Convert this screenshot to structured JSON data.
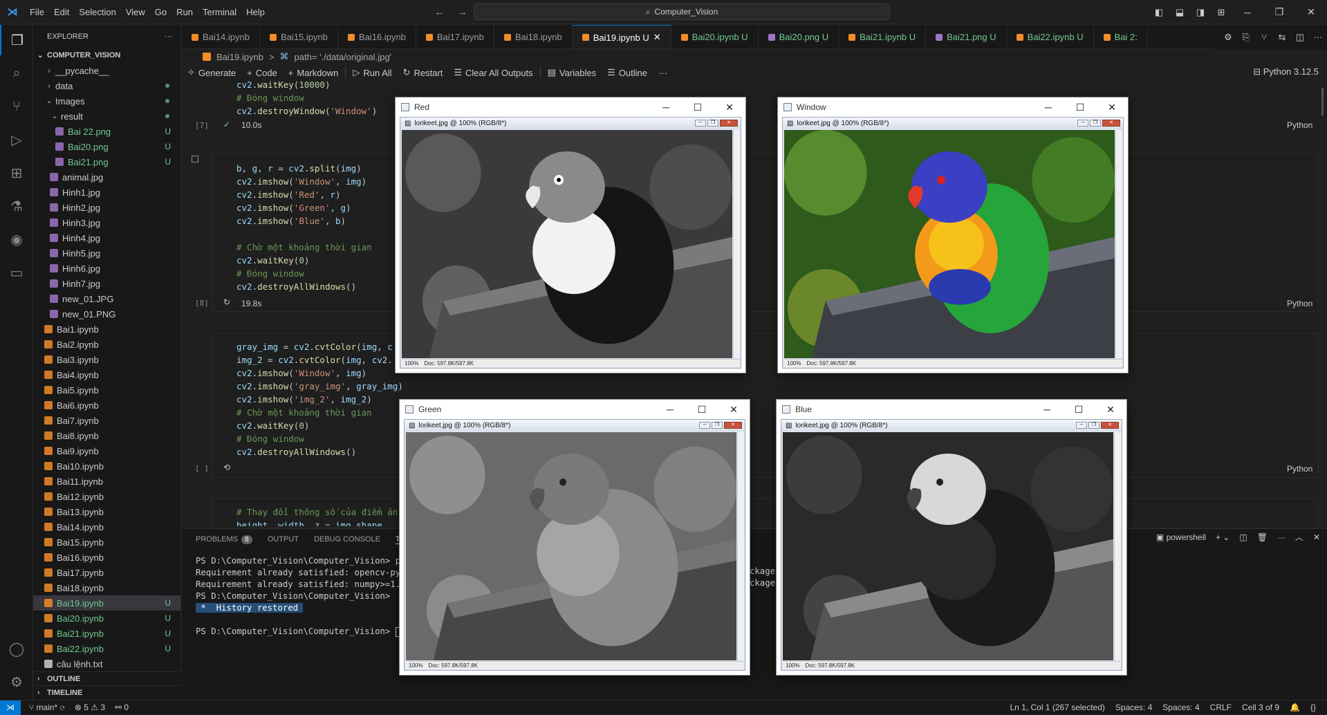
{
  "titlebar": {
    "menu": [
      "File",
      "Edit",
      "Selection",
      "View",
      "Go",
      "Run",
      "Terminal",
      "Help"
    ],
    "search": "Computer_Vision"
  },
  "sidebar": {
    "title": "EXPLORER",
    "root": "COMPUTER_VISION",
    "items": [
      {
        "label": "__pycache__",
        "indent": 1,
        "kind": "folder",
        "open": false
      },
      {
        "label": "data",
        "indent": 1,
        "kind": "folder",
        "open": false,
        "dot": true
      },
      {
        "label": "Images",
        "indent": 1,
        "kind": "folder",
        "open": true,
        "dot": true
      },
      {
        "label": "result",
        "indent": 2,
        "kind": "folder",
        "open": true,
        "dot": true
      },
      {
        "label": "Bai 22.png",
        "indent": 3,
        "kind": "png",
        "badge": "U"
      },
      {
        "label": "Bai20.png",
        "indent": 3,
        "kind": "png",
        "badge": "U"
      },
      {
        "label": "Bai21.png",
        "indent": 3,
        "kind": "png",
        "badge": "U"
      },
      {
        "label": "animal.jpg",
        "indent": 2,
        "kind": "jpg"
      },
      {
        "label": "Hinh1.jpg",
        "indent": 2,
        "kind": "jpg"
      },
      {
        "label": "Hinh2.jpg",
        "indent": 2,
        "kind": "jpg"
      },
      {
        "label": "Hinh3.jpg",
        "indent": 2,
        "kind": "jpg"
      },
      {
        "label": "Hinh4.jpg",
        "indent": 2,
        "kind": "jpg"
      },
      {
        "label": "Hinh5.jpg",
        "indent": 2,
        "kind": "jpg"
      },
      {
        "label": "Hinh6.jpg",
        "indent": 2,
        "kind": "jpg"
      },
      {
        "label": "Hinh7.jpg",
        "indent": 2,
        "kind": "jpg"
      },
      {
        "label": "new_01.JPG",
        "indent": 2,
        "kind": "jpg"
      },
      {
        "label": "new_01.PNG",
        "indent": 2,
        "kind": "jpg"
      },
      {
        "label": "Bai1.ipynb",
        "indent": 1,
        "kind": "nb"
      },
      {
        "label": "Bai2.ipynb",
        "indent": 1,
        "kind": "nb"
      },
      {
        "label": "Bai3.ipynb",
        "indent": 1,
        "kind": "nb"
      },
      {
        "label": "Bai4.ipynb",
        "indent": 1,
        "kind": "nb"
      },
      {
        "label": "Bai5.ipynb",
        "indent": 1,
        "kind": "nb"
      },
      {
        "label": "Bai6.ipynb",
        "indent": 1,
        "kind": "nb"
      },
      {
        "label": "Bai7.ipynb",
        "indent": 1,
        "kind": "nb"
      },
      {
        "label": "Bai8.ipynb",
        "indent": 1,
        "kind": "nb"
      },
      {
        "label": "Bai9.ipynb",
        "indent": 1,
        "kind": "nb"
      },
      {
        "label": "Bai10.ipynb",
        "indent": 1,
        "kind": "nb"
      },
      {
        "label": "Bai11.ipynb",
        "indent": 1,
        "kind": "nb"
      },
      {
        "label": "Bai12.ipynb",
        "indent": 1,
        "kind": "nb"
      },
      {
        "label": "Bai13.ipynb",
        "indent": 1,
        "kind": "nb"
      },
      {
        "label": "Bai14.ipynb",
        "indent": 1,
        "kind": "nb"
      },
      {
        "label": "Bai15.ipynb",
        "indent": 1,
        "kind": "nb"
      },
      {
        "label": "Bai16.ipynb",
        "indent": 1,
        "kind": "nb"
      },
      {
        "label": "Bai17.ipynb",
        "indent": 1,
        "kind": "nb"
      },
      {
        "label": "Bai18.ipynb",
        "indent": 1,
        "kind": "nb"
      },
      {
        "label": "Bai19.ipynb",
        "indent": 1,
        "kind": "nb",
        "badge": "U",
        "selected": true
      },
      {
        "label": "Bai20.ipynb",
        "indent": 1,
        "kind": "nb",
        "badge": "U"
      },
      {
        "label": "Bai21.ipynb",
        "indent": 1,
        "kind": "nb",
        "badge": "U"
      },
      {
        "label": "Bai22.ipynb",
        "indent": 1,
        "kind": "nb",
        "badge": "U"
      },
      {
        "label": "câu lệnh.txt",
        "indent": 1,
        "kind": "txt"
      }
    ],
    "outline": "OUTLINE",
    "timeline": "TIMELINE"
  },
  "tabs": [
    {
      "label": "Bai14.ipynb"
    },
    {
      "label": "Bai15.ipynb"
    },
    {
      "label": "Bai16.ipynb"
    },
    {
      "label": "Bai17.ipynb"
    },
    {
      "label": "Bai18.ipynb"
    },
    {
      "label": "Bai19.ipynb U",
      "active": true
    },
    {
      "label": "Bai20.ipynb U",
      "u": true
    },
    {
      "label": "Bai20.png U",
      "u": true
    },
    {
      "label": "Bai21.ipynb U",
      "u": true
    },
    {
      "label": "Bai21.png U",
      "u": true
    },
    {
      "label": "Bai22.ipynb U",
      "u": true
    },
    {
      "label": "Bai 2:",
      "u": true
    }
  ],
  "breadcrumb": {
    "file": "Bai19.ipynb",
    "sep": ">",
    "cell": "path= './data/original.jpg'"
  },
  "toolbar": {
    "generate": "Generate",
    "code": "Code",
    "markdown": "Markdown",
    "run_all": "Run All",
    "restart": "Restart",
    "clear": "Clear All Outputs",
    "variables": "Variables",
    "outline": "Outline",
    "more": "···",
    "kernel": "Python 3.12.5"
  },
  "cells": {
    "c7": {
      "label": "[7]",
      "time": "10.0s",
      "lang": "Python"
    },
    "c8": {
      "label": "[8]",
      "time": "19.8s",
      "lang": "Python"
    },
    "c9": {
      "label": "[ ]",
      "lang": "Python"
    }
  },
  "panel": {
    "tabs": {
      "problems": "PROBLEMS",
      "problems_count": "8",
      "output": "OUTPUT",
      "debug": "DEBUG CONSOLE",
      "terminal": "TER"
    },
    "shell": "powershell",
    "lines": [
      "PS D:\\Computer_Vision\\Computer_Vision> pip",
      "Requirement already satisfied: opencv-pyth",
      "Requirement already satisfied: numpy>=1.21",
      "PS D:\\Computer_Vision\\Computer_Vision>"
    ],
    "history": " *  History restored ",
    "prompt": "PS D:\\Computer_Vision\\Computer_Vision> ",
    "overflow1": "ckages",
    "overflow2": "ckages"
  },
  "status": {
    "branch": "main*",
    "errors": "5",
    "warnings": "3",
    "ports": "0",
    "pos": "Ln 1, Col 1 (267 selected)",
    "spaces1": "Spaces: 4",
    "spaces2": "Spaces: 4",
    "eol": "CRLF",
    "cell": "Cell 3 of 9"
  },
  "windows": [
    {
      "id": "red",
      "title": "Red",
      "inner": "lorikeet.jpg @ 100% (RGB/8*)",
      "zoom": "100%",
      "doc": "Doc: 597.8K/597.8K"
    },
    {
      "id": "window",
      "title": "Window",
      "inner": "lorikeet.jpg @ 100% (RGB/8*)",
      "zoom": "100%",
      "doc": "Doc: 597.8K/597.8K"
    },
    {
      "id": "green",
      "title": "Green",
      "inner": "lorikeet.jpg @ 100% (RGB/8*)",
      "zoom": "100%",
      "doc": "Doc: 597.8K/597.8K"
    },
    {
      "id": "blue",
      "title": "Blue",
      "inner": "lorikeet.jpg @ 100% (RGB/8*)",
      "zoom": "100%",
      "doc": "Doc: 597.8K/597.8K"
    }
  ]
}
